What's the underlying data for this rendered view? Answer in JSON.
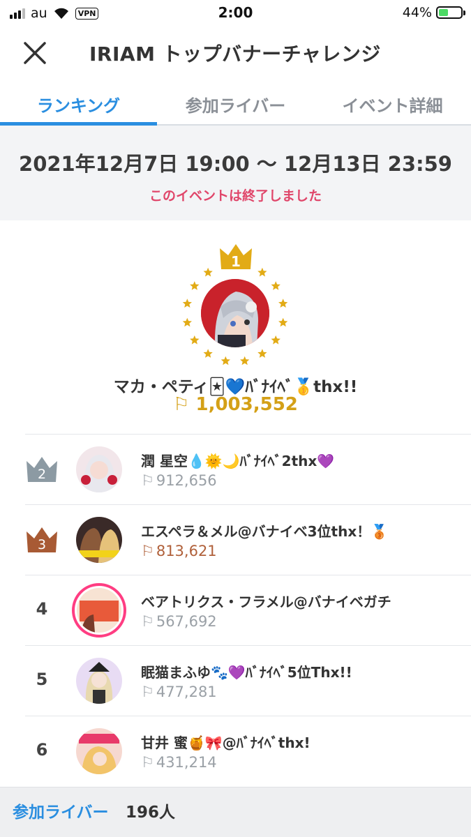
{
  "status_bar": {
    "carrier": "au",
    "vpn": "VPN",
    "time": "2:00",
    "battery": "44%",
    "battery_level": 0.44
  },
  "nav": {
    "title": "IRIAM トップバナーチャレンジ"
  },
  "tabs": [
    {
      "label": "ランキング",
      "active": true
    },
    {
      "label": "参加ライバー",
      "active": false
    },
    {
      "label": "イベント詳細",
      "active": false
    }
  ],
  "event": {
    "period": "2021年12月7日 19:00 〜 12月13日 23:59",
    "status": "このイベントは終了しました"
  },
  "winner": {
    "rank": "1",
    "name": "マカ・ペティ🃏💙ﾊﾞﾅｲﾍﾞ🥇thx!!",
    "score": "1,003,552"
  },
  "rankings": [
    {
      "rank": "2",
      "name": "潤 星空💧🌞🌙ﾊﾞﾅｲﾍﾞ2thx💜",
      "score": "912,656"
    },
    {
      "rank": "3",
      "name": "エスペラ＆メル@バナイベ3位thx！🥉",
      "score": "813,621"
    },
    {
      "rank": "4",
      "name": "ベアトリクス・フラメル@バナイベガチ",
      "score": "567,692"
    },
    {
      "rank": "5",
      "name": "眠猫まふゆ🐾💜ﾊﾞﾅｲﾍﾞ5位Thx!!",
      "score": "477,281"
    },
    {
      "rank": "6",
      "name": "甘井 蜜🍯🎀@ﾊﾞﾅｲﾍﾞthx!",
      "score": "431,214"
    }
  ],
  "footer": {
    "label": "参加ライバー",
    "count": "196人"
  },
  "colors": {
    "accent": "#2a8ee0",
    "gold": "#d4a017",
    "silver": "#8c9aa3",
    "bronze": "#a85a34",
    "alert": "#e0466a"
  },
  "icons": [
    "signal-icon",
    "wifi-icon",
    "battery-icon",
    "close-icon",
    "crown-icon",
    "star-icon",
    "flag-icon"
  ]
}
